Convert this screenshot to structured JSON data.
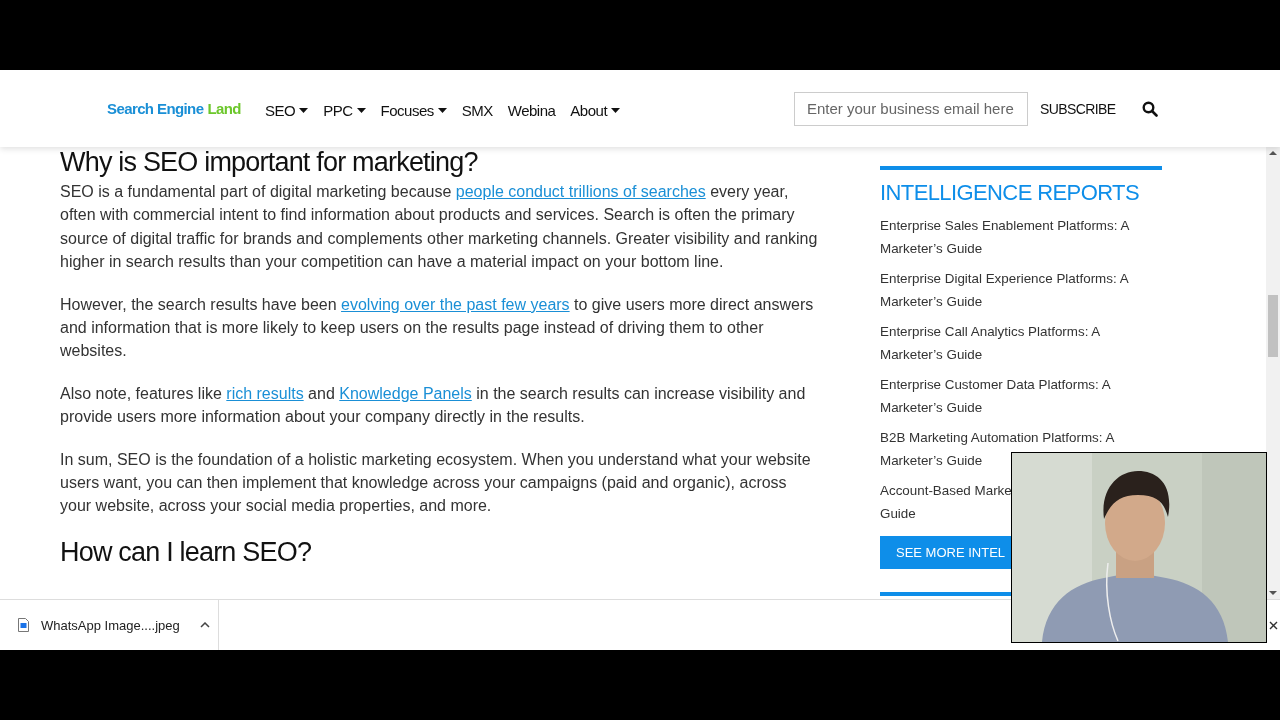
{
  "header": {
    "logo": {
      "first": "Search Engine",
      "second": "Land"
    },
    "nav": [
      {
        "label": "SEO",
        "dropdown": true
      },
      {
        "label": "PPC",
        "dropdown": true
      },
      {
        "label": "Focuses",
        "dropdown": true
      },
      {
        "label": "SMX",
        "dropdown": false
      },
      {
        "label": "Webina",
        "dropdown": false
      },
      {
        "label": "About",
        "dropdown": true
      }
    ],
    "email_field": {
      "placeholder": "Enter your business email here"
    },
    "subscribe": "SUBSCRIBE"
  },
  "article": {
    "heading": "Why is SEO important for marketing?",
    "paragraphs": [
      [
        {
          "kind": "text",
          "text": "SEO is a fundamental part of digital marketing because "
        },
        {
          "kind": "link",
          "text": "people conduct trillions of searches"
        },
        {
          "kind": "text",
          "text": " every year, often with commercial intent to find information about products and services. Search is often the primary source of digital traffic for brands and complements other marketing channels. Greater visibility and ranking higher in search results than your competition can have a material impact on your bottom line."
        }
      ],
      [
        {
          "kind": "text",
          "text": "However, the search results have been "
        },
        {
          "kind": "link",
          "text": "evolving over the past few years"
        },
        {
          "kind": "text",
          "text": " to give users more direct answers and information that is more likely to keep users on the results page instead of driving them to other websites."
        }
      ],
      [
        {
          "kind": "text",
          "text": "Also note, features like "
        },
        {
          "kind": "link",
          "text": "rich results"
        },
        {
          "kind": "text",
          "text": " and "
        },
        {
          "kind": "link",
          "text": "Knowledge Panels"
        },
        {
          "kind": "text",
          "text": " in the search results can increase visibility and provide users more information about your company directly in the results."
        }
      ],
      [
        {
          "kind": "text",
          "text": "In sum, SEO is the foundation of a holistic marketing ecosystem. When you understand what your website users want, you can then implement that knowledge across your campaigns (paid and organic), across your website, across your social media properties, and more."
        }
      ]
    ],
    "subheading": "How can I learn SEO?"
  },
  "sidebar": {
    "title": "INTELLIGENCE REPORTS",
    "items": [
      [
        "Enterprise Sales Enablement Platforms: A",
        "Marketer’s Guide"
      ],
      [
        "Enterprise Digital Experience Platforms: A",
        "Marketer’s Guide"
      ],
      [
        "Enterprise Call Analytics Platforms: A",
        "Marketer’s Guide"
      ],
      [
        "Enterprise Customer Data Platforms: A",
        "Marketer’s Guide"
      ],
      [
        "B2B Marketing Automation Platforms: A",
        "Marketer’s Guide"
      ],
      [
        "Account-Based Marke",
        "Guide"
      ]
    ],
    "button": "SEE MORE INTEL"
  },
  "downloads": [
    {
      "name": "WhatsApp Image....jpeg"
    }
  ]
}
